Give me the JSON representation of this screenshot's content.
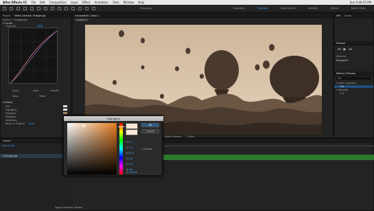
{
  "menubar": {
    "app": "After Effects CC",
    "items": [
      "File",
      "Edit",
      "Composition",
      "Layer",
      "Effect",
      "Animation",
      "View",
      "Window",
      "Help"
    ],
    "right": "Sun 9:40:15 PM"
  },
  "toolbar": {
    "snapping": "Snapping",
    "workspaces": [
      "Essentials",
      "Standard",
      "Small Screen",
      "Libraries",
      "Default"
    ],
    "active_ws": "Standard",
    "search": "Search Help"
  },
  "effect_controls": {
    "tab_project": "Project",
    "tab_ec": "Effect Controls: Vintage.jpg",
    "layer": "Comp 1 • Vintage.jpg",
    "fx": "Curves",
    "channel_label": "Channel:",
    "channel": "RGB",
    "btns": [
      "Open...",
      "Auto",
      "Smooth",
      "Save...",
      "Reset"
    ],
    "hue_fx": "Tritone",
    "props": [
      "Tint",
      "Highlights",
      "Midtones",
      "Shadows",
      "Neighbors"
    ],
    "blend_label": "Blend w. Original",
    "blend": "0.0%"
  },
  "composition": {
    "tab": "Composition: Comp 1",
    "sub_tab": "Comp 1",
    "zoom": "50%",
    "res": "Half",
    "time": "0:00:00:00",
    "view": "Active Camera",
    "views": "1 View"
  },
  "right": {
    "info": "Info",
    "audio": "Audio",
    "preview": "Preview",
    "shortcut_label": "Shortcut",
    "shortcut": "Numpad 0",
    "effects": "Effects & Presets",
    "fx_search": "tint",
    "fx_group1": "Color Correction",
    "fx_item1": "Tint",
    "fx_group2": "Obsolete",
    "fx_item2": "Tint"
  },
  "timeline": {
    "tab": "Comp 1",
    "time": "0;00;00;00",
    "layer_name": "Vintage.jpg",
    "switches": "Toggle Switches / Modes"
  },
  "picker": {
    "title": "Highlights",
    "ok": "OK",
    "cancel": "Cancel",
    "preview": "Preview",
    "h": "30 °",
    "s": "7 %",
    "b": "94 %",
    "r": "239",
    "g": "230",
    "bv": "222",
    "hex": "FAE8D6",
    "fields_left": [
      "H",
      "S",
      "B",
      "R",
      "G",
      "B"
    ]
  },
  "colors": {
    "accent": "#3ea6ff",
    "highlight": "#fae8d6",
    "sepia": "#7a6451"
  }
}
